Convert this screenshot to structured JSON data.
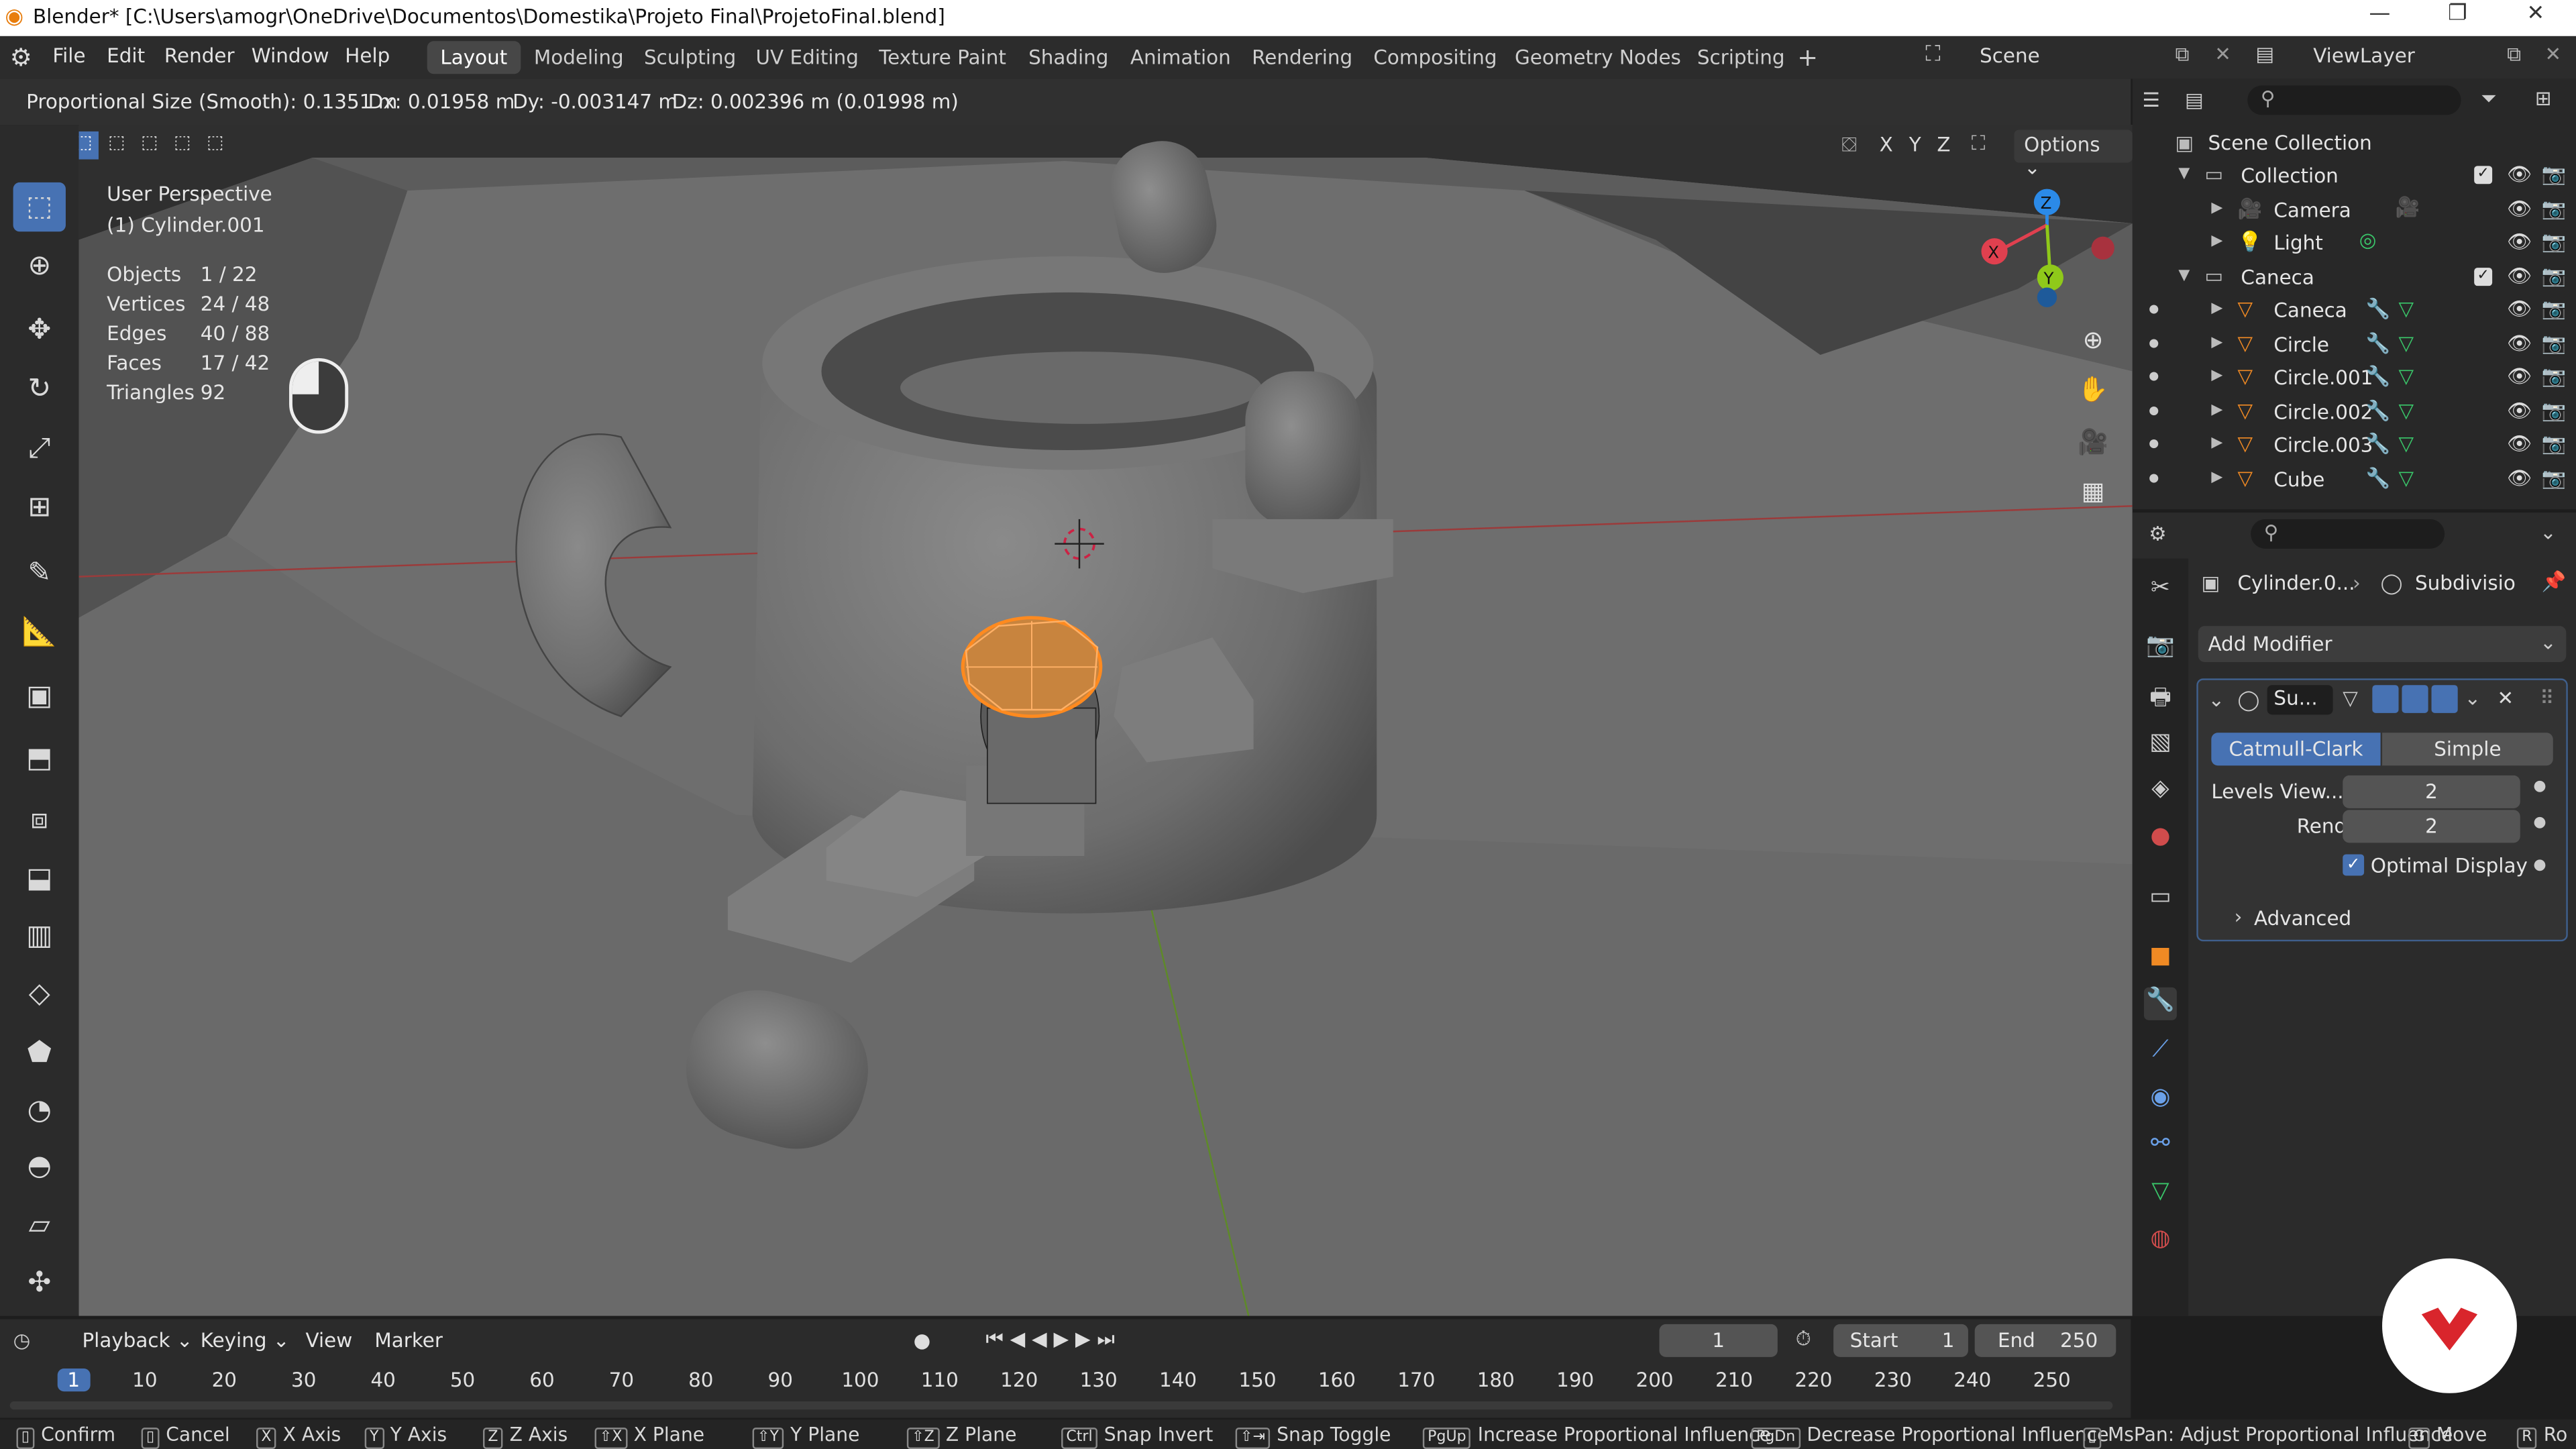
{
  "window": {
    "title": "Blender* [C:\\Users\\amogr\\OneDrive\\Documentos\\Domestika\\Projeto Final\\ProjetoFinal.blend]"
  },
  "menu": [
    "File",
    "Edit",
    "Render",
    "Window",
    "Help"
  ],
  "workspaces": [
    "Layout",
    "Modeling",
    "Sculpting",
    "UV Editing",
    "Texture Paint",
    "Shading",
    "Animation",
    "Rendering",
    "Compositing",
    "Geometry Nodes",
    "Scripting"
  ],
  "scene": {
    "label": "Scene",
    "view_layer": "ViewLayer"
  },
  "header_status": {
    "proportional": "Proportional Size (Smooth): 0.1351 m",
    "dx": "Dx: 0.01958 m",
    "dy": "Dy: -0.003147 m",
    "dz": "Dz: 0.002396 m (0.01998 m)"
  },
  "viewport": {
    "perspective": "User Perspective",
    "object": "(1) Cylinder.001",
    "stats": [
      {
        "label": "Objects",
        "value": "1 / 22"
      },
      {
        "label": "Vertices",
        "value": "24 / 48"
      },
      {
        "label": "Edges",
        "value": "40 / 88"
      },
      {
        "label": "Faces",
        "value": "17 / 42"
      },
      {
        "label": "Triangles",
        "value": "92"
      }
    ],
    "axes": [
      "X",
      "Y",
      "Z"
    ],
    "options_label": "Options"
  },
  "outliner": {
    "root": "Scene Collection",
    "rows": [
      {
        "name": "Collection"
      },
      {
        "name": "Camera"
      },
      {
        "name": "Light"
      },
      {
        "name": "Caneca"
      },
      {
        "name": "Caneca"
      },
      {
        "name": "Circle"
      },
      {
        "name": "Circle.001"
      },
      {
        "name": "Circle.002"
      },
      {
        "name": "Circle.003"
      },
      {
        "name": "Cube"
      }
    ]
  },
  "properties": {
    "breadcrumb_object": "Cylinder.0...",
    "breadcrumb_modifier": "Subdivisio",
    "add_modifier": "Add Modifier",
    "modifier_name": "Su...",
    "mode_catmull": "Catmull-Clark",
    "mode_simple": "Simple",
    "levels_label": "Levels View...",
    "levels_value": "2",
    "render_label": "Render",
    "render_value": "2",
    "optimal_display": "Optimal Display",
    "advanced": "Advanced"
  },
  "timeline": {
    "menus": [
      "Playback",
      "Keying",
      "View",
      "Marker"
    ],
    "current_frame": "1",
    "start_label": "Start",
    "start_value": "1",
    "end_label": "End",
    "end_value": "250",
    "ticks": [
      "1",
      "10",
      "20",
      "30",
      "40",
      "50",
      "60",
      "70",
      "80",
      "90",
      "100",
      "110",
      "120",
      "130",
      "140",
      "150",
      "160",
      "170",
      "180",
      "190",
      "200",
      "210",
      "220",
      "230",
      "240",
      "250"
    ]
  },
  "statusbar": [
    {
      "key": "",
      "label": "Confirm"
    },
    {
      "key": "",
      "label": "Cancel"
    },
    {
      "key": "X",
      "label": "X Axis"
    },
    {
      "key": "Y",
      "label": "Y Axis"
    },
    {
      "key": "Z",
      "label": "Z Axis"
    },
    {
      "key": "⇧X",
      "label": "X Plane"
    },
    {
      "key": "⇧Y",
      "label": "Y Plane"
    },
    {
      "key": "⇧Z",
      "label": "Z Plane"
    },
    {
      "key": "Ctrl",
      "label": "Snap Invert"
    },
    {
      "key": "⇧⇥",
      "label": "Snap Toggle"
    },
    {
      "key": "PgUp",
      "label": "Increase Proportional Influence"
    },
    {
      "key": "PgDn",
      "label": "Decrease Proportional Influence"
    },
    {
      "key": "",
      "label": "MsPan: Adjust Proportional Influence"
    },
    {
      "key": "G",
      "label": "Move"
    },
    {
      "key": "R",
      "label": "Ro"
    }
  ],
  "colors": {
    "accent": "#4772b3",
    "selection": "#ff8a1f",
    "axis_x": "#e0404f",
    "axis_y": "#8fc91a",
    "axis_z": "#2b8ae8",
    "brand": "#d9252c"
  }
}
